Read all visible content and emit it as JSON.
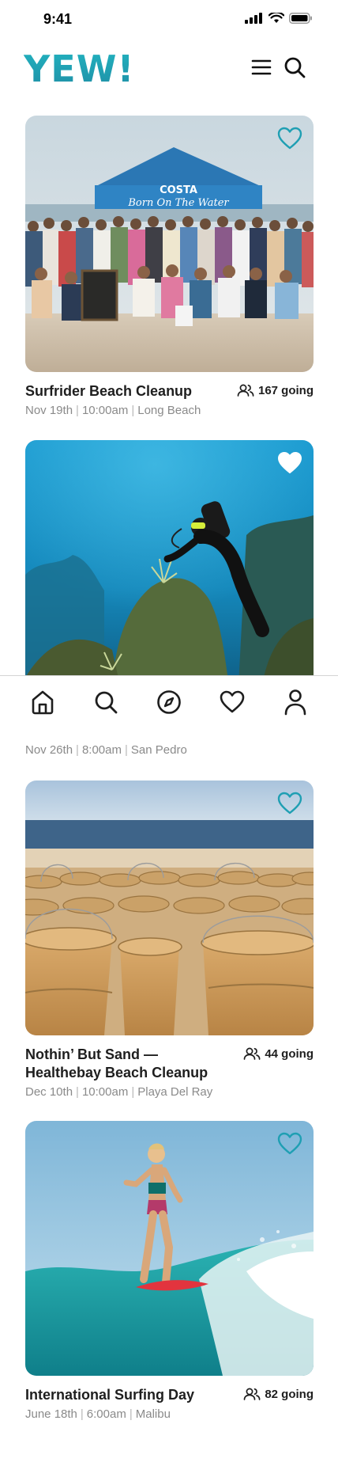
{
  "status": {
    "time": "9:41"
  },
  "header": {
    "logo": "YEW!",
    "menu_icon": "menu-icon",
    "search_icon": "search-icon"
  },
  "colors": {
    "brand": "#1f9fb3",
    "title": "#1e1e1e",
    "meta": "#8a8a8a"
  },
  "events": [
    {
      "title": "Surfrider Beach Cleanup",
      "going": "167 going",
      "date": "Nov 19th",
      "time": "10:00am",
      "place": "Long Beach",
      "favorited": false,
      "image_text": {
        "tent": "COSTA",
        "banner": "Born On The Water"
      }
    },
    {
      "title": "",
      "going": "",
      "date": "Nov 26th",
      "time": "8:00am",
      "place": "San Pedro",
      "favorited": true
    },
    {
      "title": "Nothin’ But Sand — Healthebay Beach Cleanup",
      "going": "44 going",
      "date": "Dec 10th",
      "time": "10:00am",
      "place": "Playa Del Ray",
      "favorited": false
    },
    {
      "title": "International Surfing Day",
      "going": "82 going",
      "date": "June 18th",
      "time": "6:00am",
      "place": "Malibu",
      "favorited": false
    }
  ],
  "tabs": [
    {
      "name": "home",
      "icon": "home-icon"
    },
    {
      "name": "search",
      "icon": "search-icon"
    },
    {
      "name": "explore",
      "icon": "compass-icon"
    },
    {
      "name": "favorites",
      "icon": "heart-icon"
    },
    {
      "name": "profile",
      "icon": "user-icon"
    }
  ]
}
